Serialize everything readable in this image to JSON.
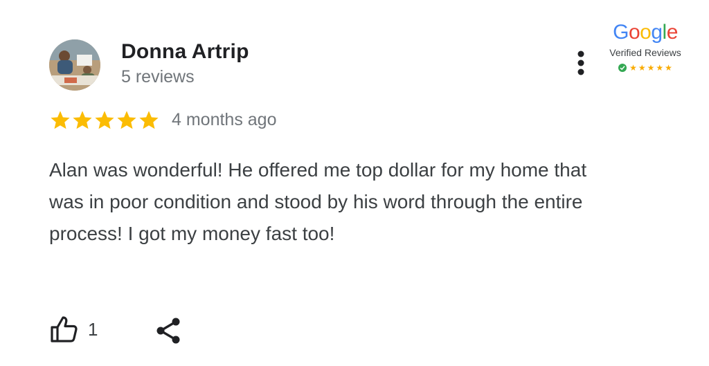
{
  "reviewer": {
    "name": "Donna Artrip",
    "review_count": "5 reviews",
    "avatar_icon": "user-photo-avatar"
  },
  "badge": {
    "logo_letters": [
      "G",
      "o",
      "o",
      "g",
      "l",
      "e"
    ],
    "logo_colors": [
      "#4285F4",
      "#EA4335",
      "#FBBC05",
      "#4285F4",
      "#34A853",
      "#EA4335"
    ],
    "label": "Verified Reviews",
    "star_count": 5,
    "check_color": "#34A853",
    "star_color": "#F9AB00"
  },
  "review": {
    "rating": 5,
    "time": "4 months ago",
    "text": "Alan was wonderful! He offered me top dollar for my home that was in poor condition and stood by his word through the entire process! I got my money fast too!",
    "star_color": "#FBBC04"
  },
  "actions": {
    "like_count": "1",
    "like_icon": "thumbs-up-icon",
    "share_icon": "share-icon",
    "more_icon": "more-vert-icon"
  }
}
